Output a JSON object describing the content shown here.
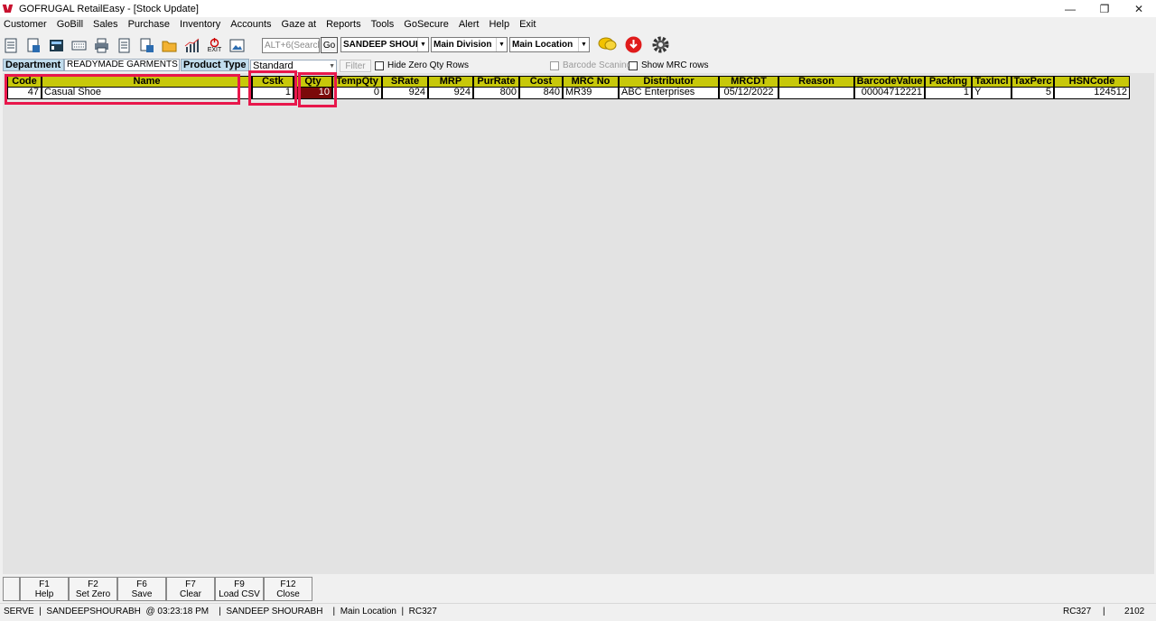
{
  "window": {
    "title": "GOFRUGAL RetailEasy - [Stock Update]",
    "controls": [
      "—",
      "❐",
      "✕"
    ]
  },
  "menu": [
    "Customer",
    "GoBill",
    "Sales",
    "Purchase",
    "Inventory",
    "Accounts",
    "Gaze at",
    "Reports",
    "Tools",
    "GoSecure",
    "Alert",
    "Help",
    "Exit"
  ],
  "toolbar": {
    "icons": [
      "new-doc-icon",
      "save-doc-icon",
      "calculator-icon",
      "keyboard-icon",
      "print-icon",
      "notepad-icon",
      "transfer-icon",
      "folder-icon",
      "chart-icon",
      "exit-icon",
      "picture-icon"
    ],
    "exit_label": "EXIT",
    "search_placeholder": "ALT+6(Search)",
    "go_label": "Go",
    "user_select": "SANDEEP SHOURA",
    "division_select": "Main Division",
    "location_select": "Main Location",
    "extra_icons": [
      "chat-icon",
      "download-icon",
      "settings-icon"
    ]
  },
  "filters": {
    "department_label": "Department",
    "department_value": "READYMADE GARMENTS",
    "product_type_label": "Product Type",
    "product_type_value": "Standard",
    "filter_button": "Filter",
    "hide_zero_label": "Hide Zero Qty Rows",
    "barcode_scanning_label": "Barcode Scaning",
    "show_mrc_label": "Show MRC rows"
  },
  "grid": {
    "columns": [
      "Code",
      "Name",
      "Cstk",
      "Qty",
      "TempQty",
      "SRate",
      "MRP",
      "PurRate",
      "Cost",
      "MRC No",
      "Distributor",
      "MRCDT",
      "Reason",
      "BarcodeValue",
      "Packing",
      "TaxIncl",
      "TaxPerc",
      "HSNCode"
    ],
    "rows": [
      [
        "47",
        "Casual Shoe",
        "1",
        "10",
        "0",
        "924",
        "924",
        "800",
        "840",
        "MR39",
        "ABC Enterprises",
        "05/12/2022",
        "",
        "00004712221",
        "1",
        "Y",
        "5",
        "124512"
      ]
    ]
  },
  "fkeys": [
    {
      "key": "F1",
      "label": "Help"
    },
    {
      "key": "F2",
      "label": "Set Zero"
    },
    {
      "key": "F6",
      "label": "Save"
    },
    {
      "key": "F7",
      "label": "Clear"
    },
    {
      "key": "F9",
      "label": "Load CSV"
    },
    {
      "key": "F12",
      "label": "Close"
    }
  ],
  "status": {
    "left": "SERVE  |  SANDEEPSHOURABH  @ 03:23:18 PM    |  SANDEEP SHOURABH    |  Main Location  |  RC327",
    "right1": "RC327",
    "sep": "|",
    "right2": "2102"
  },
  "colors": {
    "grid_header": "#c7c80a",
    "selected_cell": "#7b0a0a",
    "highlight": "#e8174b",
    "label_bg": "#c0dcec"
  }
}
